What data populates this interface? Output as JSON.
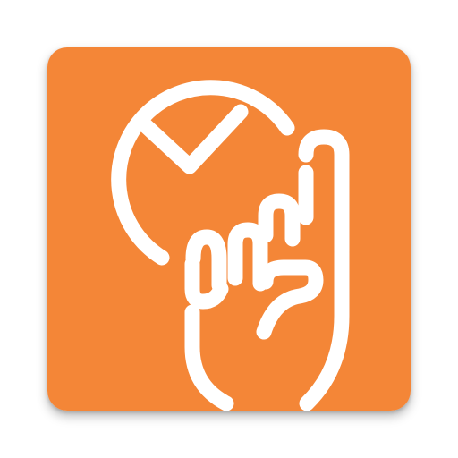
{
  "app_icon": {
    "icon": "clock-with-pointing-hand-icon",
    "background_color": "#F48637",
    "foreground_color": "#FFFFFF"
  }
}
